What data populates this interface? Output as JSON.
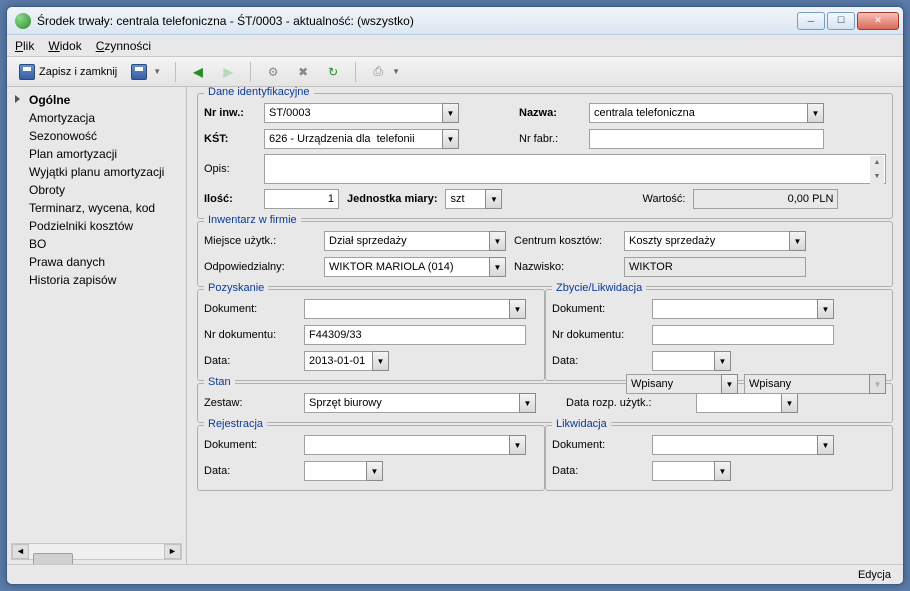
{
  "window": {
    "title": "Środek trwały: centrala telefoniczna - ŚT/0003 - aktualność: (wszystko)"
  },
  "menu": {
    "file": "Plik",
    "view": "Widok",
    "actions": "Czynności"
  },
  "toolbar": {
    "save_close": "Zapisz i zamknij"
  },
  "sidebar": {
    "items": [
      "Ogólne",
      "Amortyzacja",
      "Sezonowość",
      "Plan amortyzacji",
      "Wyjątki planu amortyzacji",
      "Obroty",
      "Terminarz, wycena, kod",
      "Podzielniki kosztów",
      "BO",
      "Prawa danych",
      "Historia zapisów"
    ],
    "selected": 0
  },
  "ident": {
    "legend": "Dane identyfikacyjne",
    "nr_inw_label": "Nr inw.:",
    "nr_inw": "ŚT/0003",
    "nazwa_label": "Nazwa:",
    "nazwa": "centrala telefoniczna",
    "kst_label": "KŚT:",
    "kst": "626 - Urządzenia dla  telefonii",
    "nr_fabr_label": "Nr fabr.:",
    "nr_fabr": "",
    "opis_label": "Opis:",
    "opis": "",
    "ilosc_label": "Ilość:",
    "ilosc": "1",
    "jm_label": "Jednostka miary:",
    "jm": "szt",
    "wartosc_label": "Wartość:",
    "wartosc": "0,00 PLN"
  },
  "inw": {
    "legend": "Inwentarz w firmie",
    "miejsce_label": "Miejsce użytk.:",
    "miejsce": "Dział sprzedaży",
    "centrum_label": "Centrum kosztów:",
    "centrum": "Koszty sprzedaży",
    "odp_label": "Odpowiedzialny:",
    "odp": "WIKTOR MARIOLA (014)",
    "nazwisko_label": "Nazwisko:",
    "nazwisko": "WIKTOR"
  },
  "poz": {
    "legend": "Pozyskanie",
    "dokument_label": "Dokument:",
    "dokument": "",
    "nr_label": "Nr dokumentu:",
    "nr": "F44309/33",
    "data_label": "Data:",
    "data": "2013-01-01"
  },
  "zby": {
    "legend": "Zbycie/Likwidacja",
    "dokument_label": "Dokument:",
    "dokument": "",
    "nr_label": "Nr dokumentu:",
    "nr": "",
    "data_label": "Data:",
    "data": ""
  },
  "stan": {
    "legend": "Stan",
    "zestaw_label": "Zestaw:",
    "zestaw": "Sprzęt biurowy",
    "poz_status": "Wpisany",
    "zby_status": "Wpisany",
    "data_rozp_label": "Data rozp. użytk.:",
    "data_rozp": ""
  },
  "rej": {
    "legend": "Rejestracja",
    "dokument_label": "Dokument:",
    "dokument": "",
    "data_label": "Data:",
    "data": ""
  },
  "lik": {
    "legend": "Likwidacja",
    "dokument_label": "Dokument:",
    "dokument": "",
    "data_label": "Data:",
    "data": ""
  },
  "status": {
    "mode": "Edycja"
  }
}
